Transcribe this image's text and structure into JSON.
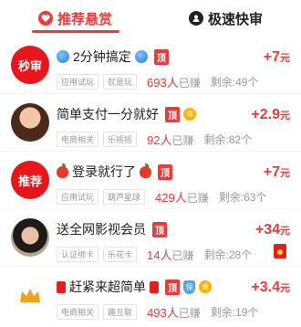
{
  "tabs": [
    {
      "label": "推荐悬赏",
      "active": true
    },
    {
      "label": "极速快审",
      "active": false
    }
  ],
  "tasks": [
    {
      "avatar_text": "秒审",
      "avatar_tag": "",
      "title": "2分钟搞定",
      "badge": "顶",
      "tags": [
        "应用试玩",
        "就是玩"
      ],
      "earned_count": "693人",
      "earned_suffix": "已赚",
      "remaining": "剩余:49个",
      "reward_value": "+7",
      "reward_unit": "元"
    },
    {
      "avatar_text": "",
      "avatar_tag": "",
      "title": "简单支付一分就好",
      "badge": "顶",
      "badge2": "保",
      "tags": [
        "电商相关",
        "乐摇摇"
      ],
      "earned_count": "92人",
      "earned_suffix": "已赚",
      "remaining": "剩余:82个",
      "reward_value": "+2.9",
      "reward_unit": "元"
    },
    {
      "avatar_text": "推荐",
      "avatar_tag": "",
      "title": "登录就行了",
      "badge": "顶",
      "tags": [
        "应用试玩",
        "葫芦星球"
      ],
      "earned_count": "429人",
      "earned_suffix": "已赚",
      "remaining": "剩余:63个",
      "reward_value": "+7",
      "reward_unit": "元"
    },
    {
      "avatar_text": "",
      "avatar_tag": "",
      "title": "送全网影视会员",
      "badge": "顶",
      "tags": [
        "认证绑卡",
        "乐花卡"
      ],
      "earned_count": "14人",
      "earned_suffix": "已赚",
      "remaining": "剩余:28个",
      "reward_value": "+34",
      "reward_unit": "元"
    },
    {
      "avatar_text": "",
      "avatar_tag": "",
      "title": "赶紧来超简单",
      "badge": "顶",
      "badge2": "保",
      "tags": [
        "电商相关",
        "趣互联"
      ],
      "earned_count": "493人",
      "earned_suffix": "已赚",
      "remaining": "剩余:19个",
      "reward_value": "+3.4",
      "reward_unit": "元"
    }
  ],
  "colors": {
    "accent": "#f03a3a",
    "muted": "#999999",
    "chip_border": "#e5e5e5"
  }
}
